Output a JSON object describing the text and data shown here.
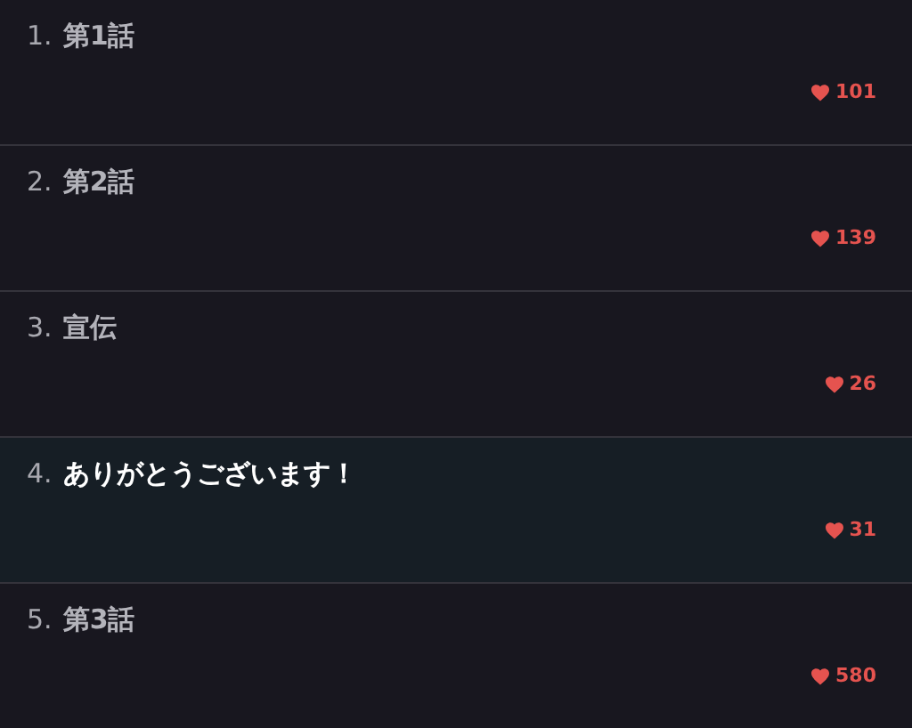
{
  "episodes": [
    {
      "number": "1.",
      "title": "第1話",
      "likes": "101",
      "selected": false
    },
    {
      "number": "2.",
      "title": "第2話",
      "likes": "139",
      "selected": false
    },
    {
      "number": "3.",
      "title": "宣伝",
      "likes": "26",
      "selected": false
    },
    {
      "number": "4.",
      "title": "ありがとうございます！",
      "likes": "31",
      "selected": true
    },
    {
      "number": "5.",
      "title": "第3話",
      "likes": "580",
      "selected": false
    }
  ]
}
